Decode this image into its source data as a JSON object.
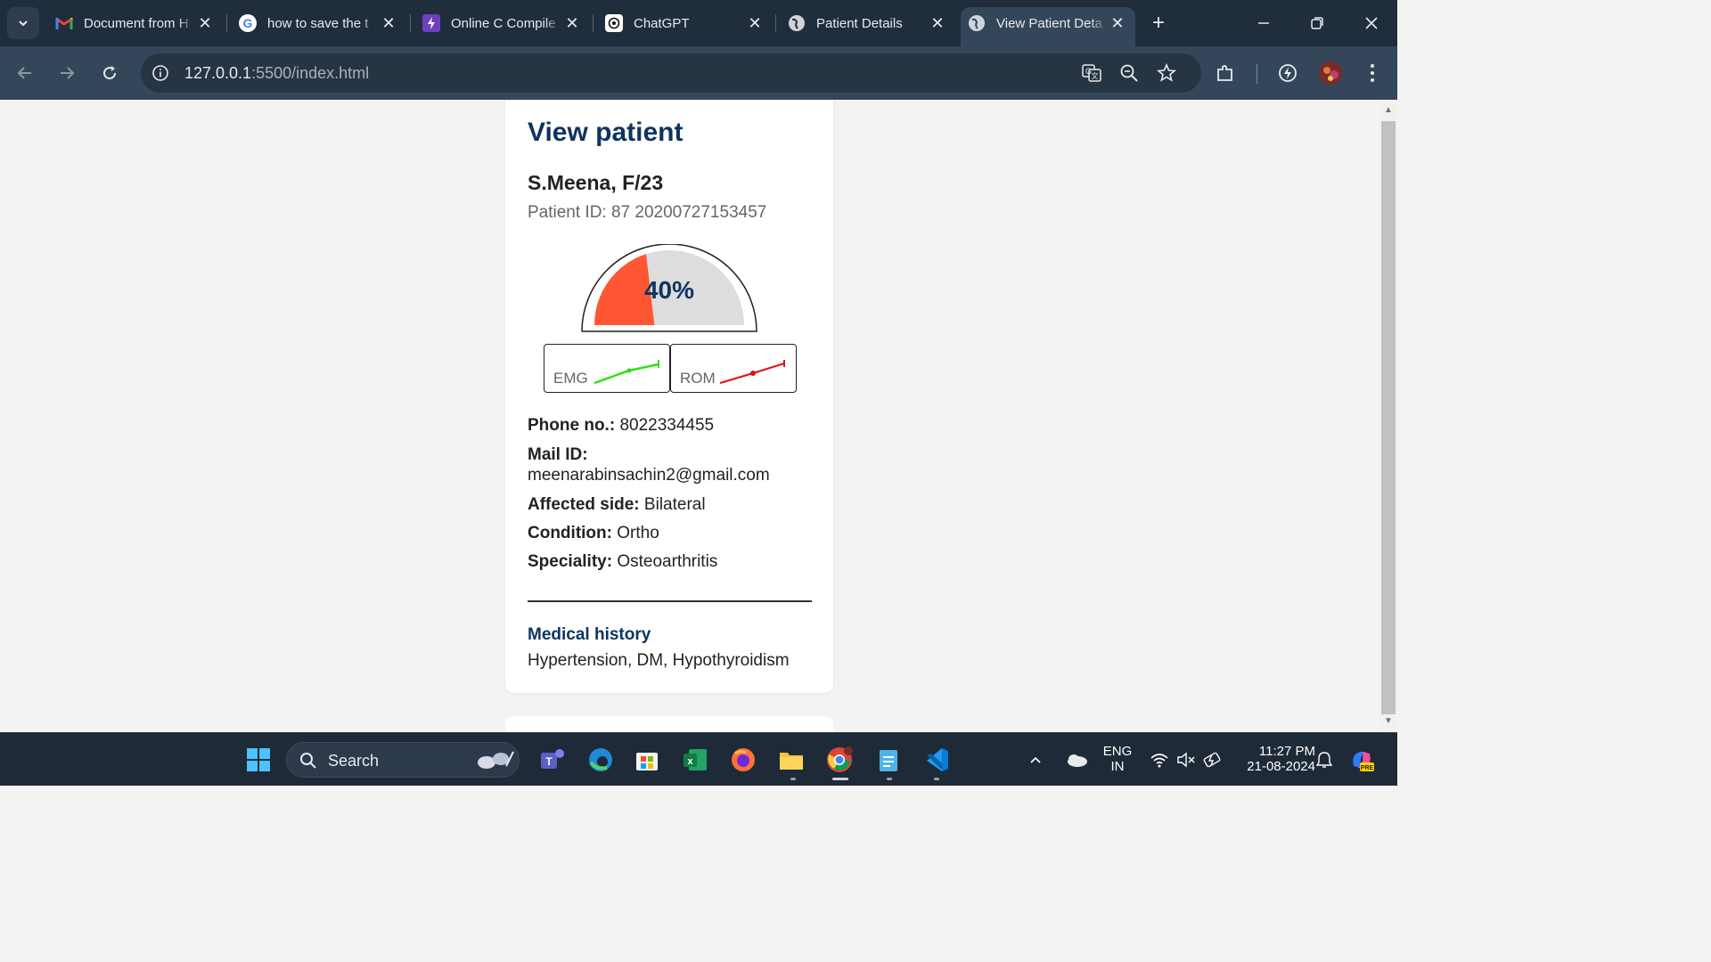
{
  "browser": {
    "tabs": [
      {
        "title": "Document from H",
        "icon": "gmail-icon"
      },
      {
        "title": "how to save the t",
        "icon": "google-icon"
      },
      {
        "title": "Online C Compile",
        "icon": "bolt-icon"
      },
      {
        "title": "ChatGPT",
        "icon": "chatgpt-icon"
      },
      {
        "title": "Patient Details",
        "icon": "globe-icon"
      },
      {
        "title": "View Patient Deta",
        "icon": "globe-icon",
        "active": true
      }
    ],
    "url_host": "127.0.0.1",
    "url_rest": ":5500/index.html"
  },
  "page": {
    "title": "View patient",
    "patient_name": "S.Meena, F/23",
    "patient_id": "Patient ID: 87 20200727153457",
    "progress_percent_label": "40%",
    "progress_fraction": 0.4,
    "emg_label": "EMG",
    "rom_label": "ROM",
    "fields": [
      {
        "label": "Phone no.:",
        "value": "8022334455"
      },
      {
        "label": "Mail ID:",
        "value": "meenarabinsachin2@gmail.com"
      },
      {
        "label": "Affected side:",
        "value": "Bilateral"
      },
      {
        "label": "Condition:",
        "value": "Ortho"
      },
      {
        "label": "Speciality:",
        "value": "Osteoarthritis"
      }
    ],
    "medical_history_title": "Medical history",
    "medical_history_text": "Hypertension, DM, Hypothyroidism"
  },
  "colors": {
    "accent": "#0e3460",
    "gauge_fill": "#ff5733",
    "gauge_bg": "#dddddd",
    "emg_line": "#33dd11",
    "rom_line": "#dd1111"
  },
  "taskbar": {
    "search_label": "Search",
    "lang_top": "ENG",
    "lang_bottom": "IN",
    "time": "11:27 PM",
    "date": "21-08-2024"
  }
}
